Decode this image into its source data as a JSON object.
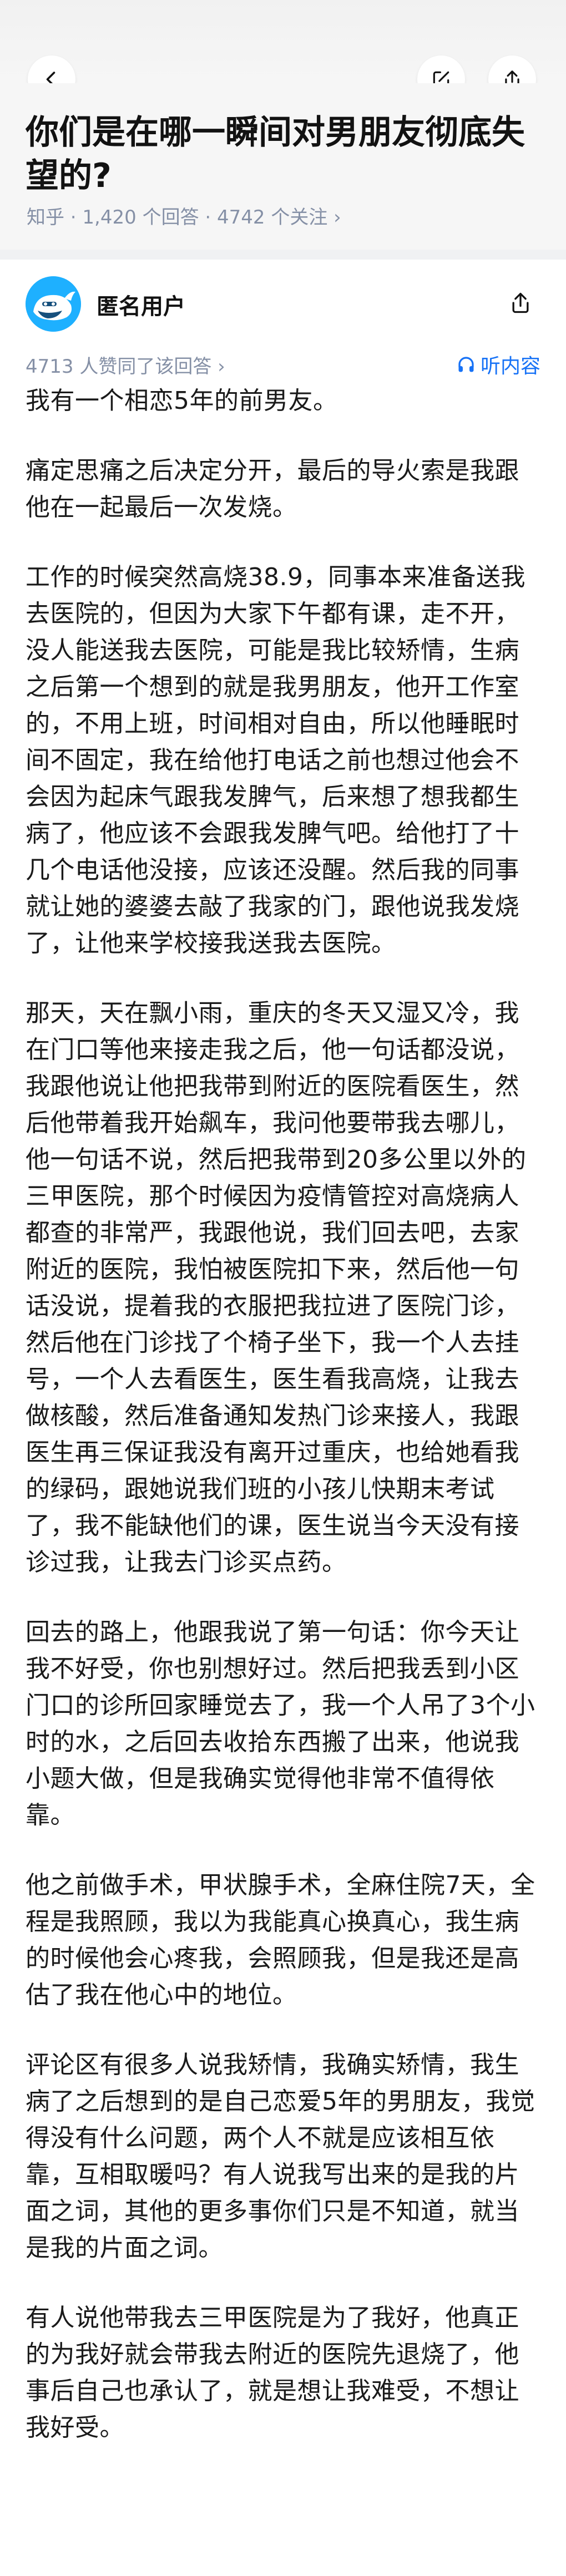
{
  "question": {
    "title": "你们是在哪一瞬间对男朋友彻底失望的?",
    "meta": "知乎 · 1,420 个回答 · 4742 个关注 ›"
  },
  "answer": {
    "author": "匿名用户",
    "upvotes": "4713 人赞同了该回答 ›",
    "listen_label": "听内容",
    "paragraphs": [
      "我有一个相恋5年的前男友。",
      "痛定思痛之后决定分开，最后的导火索是我跟他在一起最后一次发烧。",
      "工作的时候突然高烧38.9，同事本来准备送我去医院的，但因为大家下午都有课，走不开，没人能送我去医院，可能是我比较矫情，生病之后第一个想到的就是我男朋友，他开工作室的，不用上班，时间相对自由，所以他睡眠时间不固定，我在给他打电话之前也想过他会不会因为起床气跟我发脾气，后来想了想我都生病了，他应该不会跟我发脾气吧。给他打了十几个电话他没接，应该还没醒。然后我的同事就让她的婆婆去敲了我家的门，跟他说我发烧了，让他来学校接我送我去医院。",
      "那天，天在飘小雨，重庆的冬天又湿又冷，我在门口等他来接走我之后，他一句话都没说，我跟他说让他把我带到附近的医院看医生，然后他带着我开始飙车，我问他要带我去哪儿，他一句话不说，然后把我带到20多公里以外的三甲医院，那个时候因为疫情管控对高烧病人都查的非常严，我跟他说，我们回去吧，去家附近的医院，我怕被医院扣下来，然后他一句话没说，提着我的衣服把我拉进了医院门诊，然后他在门诊找了个椅子坐下，我一个人去挂号，一个人去看医生，医生看我高烧，让我去做核酸，然后准备通知发热门诊来接人，我跟医生再三保证我没有离开过重庆，也给她看我的绿码，跟她说我们班的小孩儿快期末考试了，我不能缺他们的课，医生说当今天没有接诊过我，让我去门诊买点药。",
      "回去的路上，他跟我说了第一句话：你今天让我不好受，你也别想好过。然后把我丢到小区门口的诊所回家睡觉去了，我一个人吊了3个小时的水，之后回去收拾东西搬了出来，他说我小题大做，但是我确实觉得他非常不值得依靠。",
      "他之前做手术，甲状腺手术，全麻住院7天，全程是我照顾，我以为我能真心换真心，我生病的时候他会心疼我，会照顾我，但是我还是高估了我在他心中的地位。",
      "评论区有很多人说我矫情，我确实矫情，我生病了之后想到的是自己恋爱5年的男朋友，我觉得没有什么问题，两个人不就是应该相互依靠，互相取暖吗？有人说我写出来的是我的片面之词，其他的更多事你们只是不知道，就当是我的片面之词。",
      "有人说他带我去三甲医院是为了我好，他真正的为我好就会带我去附近的医院先退烧了，他事后自己也承认了，就是想让我难受，不想让我好受。"
    ]
  },
  "icons": {
    "back": "chevron-left-icon",
    "edit": "edit-icon",
    "share": "share-icon",
    "listen": "headphones-icon",
    "avatar": "anonymous-whale-avatar"
  },
  "colors": {
    "accent": "#1772f6",
    "meta_text": "#8590a6",
    "avatar_bg": "#1eb0ff"
  }
}
